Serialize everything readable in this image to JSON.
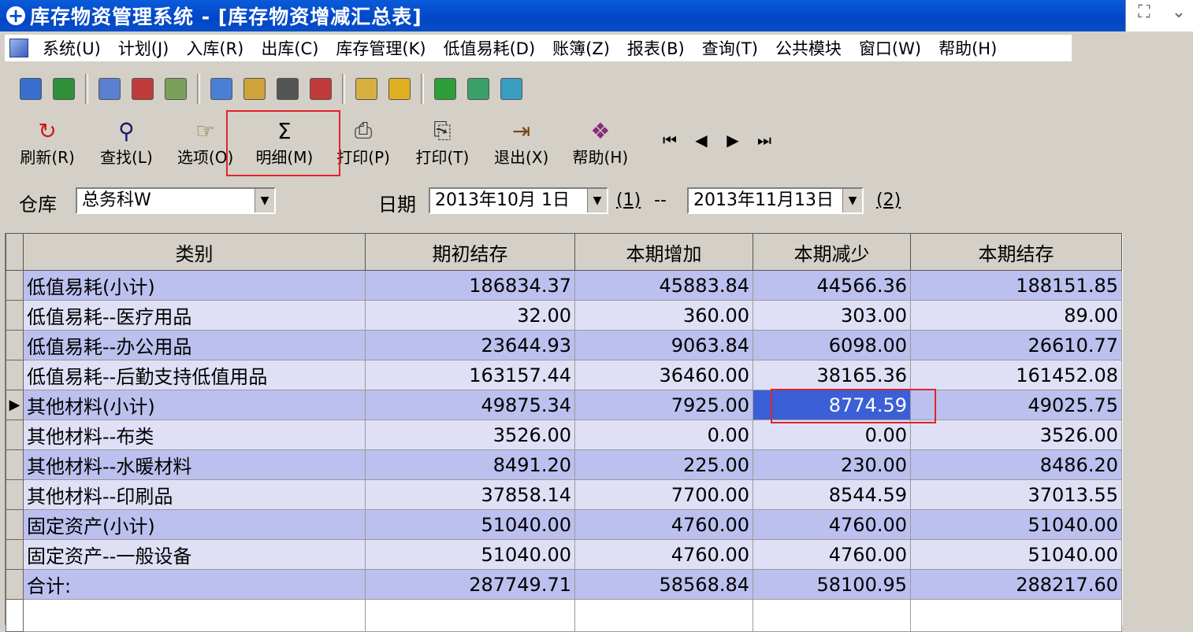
{
  "window": {
    "title": "库存物资管理系统 - [库存物资增减汇总表]",
    "controls": [
      "⛶",
      "⌄"
    ]
  },
  "menu": [
    "系统(U)",
    "计划(J)",
    "入库(R)",
    "出库(C)",
    "库存管理(K)",
    "低值易耗(D)",
    "账簿(Z)",
    "报表(B)",
    "查询(T)",
    "公共模块",
    "窗口(W)",
    "帮助(H)"
  ],
  "toolbar_icons": [
    {
      "name": "import-icon",
      "color": "#3a6fd0"
    },
    {
      "name": "check-doc-icon",
      "color": "#2f8f3a"
    },
    {
      "name": "form-icon",
      "color": "#5c7fd0"
    },
    {
      "name": "export-icon",
      "color": "#c23b3b"
    },
    {
      "name": "scan-icon",
      "color": "#7aa05a"
    },
    {
      "name": "magnifier-icon",
      "color": "#4a7fd8"
    },
    {
      "name": "edit-icon",
      "color": "#d0a23a"
    },
    {
      "name": "grid-icon",
      "color": "#555555"
    },
    {
      "name": "transfer-icon",
      "color": "#c03a3a"
    },
    {
      "name": "folder-icon",
      "color": "#d8b040"
    },
    {
      "name": "thermometer-icon",
      "color": "#e0b020"
    },
    {
      "name": "stop-icon",
      "color": "#2e9e3a"
    },
    {
      "name": "book-icon",
      "color": "#3aa06a"
    },
    {
      "name": "close-box-icon",
      "color": "#3a9ec0"
    }
  ],
  "actions": [
    {
      "label": "刷新(R)",
      "icon": "refresh-icon",
      "glyph": "↻",
      "color": "#d01818"
    },
    {
      "label": "查找(L)",
      "icon": "search-icon",
      "glyph": "⚲",
      "color": "#1a1a6e"
    },
    {
      "label": "选项(O)",
      "icon": "options-icon",
      "glyph": "☞",
      "color": "#8a6a2a"
    },
    {
      "label": "明细(M)",
      "icon": "sigma-icon",
      "glyph": "Σ",
      "color": "#000000"
    },
    {
      "label": "打印(P)",
      "icon": "printer-icon",
      "glyph": "⎙",
      "color": "#333333"
    },
    {
      "label": "打印(T)",
      "icon": "print-preview-icon",
      "glyph": "⎘",
      "color": "#333333"
    },
    {
      "label": "退出(X)",
      "icon": "exit-icon",
      "glyph": "⇥",
      "color": "#7a4a1a"
    },
    {
      "label": "帮助(H)",
      "icon": "help-book-icon",
      "glyph": "❖",
      "color": "#8a2a7a"
    }
  ],
  "nav": [
    "⏮",
    "◀",
    "▶",
    "⏭"
  ],
  "filter": {
    "store_label": "仓库",
    "store_value": "总务科W",
    "date_label": "日期",
    "date_from": "2013年10月 1日",
    "date_sep": "--",
    "date_to": "2013年11月13日",
    "link1": "(1)",
    "link2": "(2)"
  },
  "table": {
    "headers": [
      "类别",
      "期初结存",
      "本期增加",
      "本期减少",
      "本期结存"
    ],
    "rows": [
      {
        "cat": "低值易耗(小计)",
        "opening": "186834.37",
        "increase": "45883.84",
        "decrease": "44566.36",
        "closing": "188151.85"
      },
      {
        "cat": "低值易耗--医疗用品",
        "opening": "32.00",
        "increase": "360.00",
        "decrease": "303.00",
        "closing": "89.00"
      },
      {
        "cat": "低值易耗--办公用品",
        "opening": "23644.93",
        "increase": "9063.84",
        "decrease": "6098.00",
        "closing": "26610.77"
      },
      {
        "cat": "低值易耗--后勤支持低值用品",
        "opening": "163157.44",
        "increase": "36460.00",
        "decrease": "38165.36",
        "closing": "161452.08"
      },
      {
        "cat": "其他材料(小计)",
        "opening": "49875.34",
        "increase": "7925.00",
        "decrease": "8774.59",
        "closing": "49025.75"
      },
      {
        "cat": "其他材料--布类",
        "opening": "3526.00",
        "increase": "0.00",
        "decrease": "0.00",
        "closing": "3526.00"
      },
      {
        "cat": "其他材料--水暖材料",
        "opening": "8491.20",
        "increase": "225.00",
        "decrease": "230.00",
        "closing": "8486.20"
      },
      {
        "cat": "其他材料--印刷品",
        "opening": "37858.14",
        "increase": "7700.00",
        "decrease": "8544.59",
        "closing": "37013.55"
      },
      {
        "cat": "固定资产(小计)",
        "opening": "51040.00",
        "increase": "4760.00",
        "decrease": "4760.00",
        "closing": "51040.00"
      },
      {
        "cat": "固定资产--一般设备",
        "opening": "51040.00",
        "increase": "4760.00",
        "decrease": "4760.00",
        "closing": "51040.00"
      },
      {
        "cat": "合计:",
        "opening": "287749.71",
        "increase": "58568.84",
        "decrease": "58100.95",
        "closing": "288217.60"
      }
    ],
    "current_row_marker": "▶",
    "selected_row": 4,
    "selected_col": "decrease"
  },
  "colors": {
    "title_bar": "#0a4ec8",
    "row_odd": "#bcc0ee",
    "row_even": "#dfe0f6",
    "selection": "#3b5fd6",
    "highlight": "#e0242a"
  }
}
